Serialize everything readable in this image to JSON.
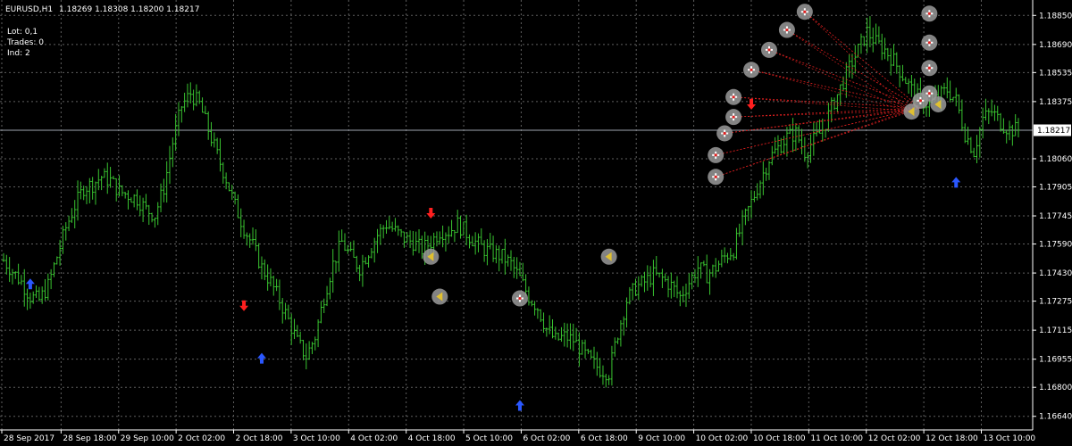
{
  "header": {
    "symbol": "EURUSD,H1",
    "ohlc": "1.18269 1.18308 1.18200 1.18217"
  },
  "info": {
    "lot": "Lot: 0,1",
    "trades": "Trades: 0",
    "ind": "Ind: 2"
  },
  "colors": {
    "background": "#000000",
    "grid": "#5f5f5f",
    "candles": "#39c430",
    "buy_arrow": "#2a57ff",
    "sell_arrow": "#ff1f1f",
    "trade_line": "#e02020",
    "marker": "#9a9a9a",
    "current_price_line": "#9fa6b0"
  },
  "chart_data": {
    "type": "candlestick",
    "symbol": "EURUSD",
    "timeframe": "H1",
    "ylim": [
      1.16565,
      1.18935
    ],
    "current_price": "1.18217",
    "y_ticks": [
      "1.18850",
      "1.18690",
      "1.18535",
      "1.18375",
      "1.18217",
      "1.18060",
      "1.17905",
      "1.17745",
      "1.17590",
      "1.17430",
      "1.17275",
      "1.17115",
      "1.16955",
      "1.16800",
      "1.16640"
    ],
    "x_ticks": [
      "28 Sep 2017",
      "28 Sep 18:00",
      "29 Sep 10:00",
      "2 Oct 02:00",
      "2 Oct 18:00",
      "3 Oct 10:00",
      "4 Oct 02:00",
      "4 Oct 18:00",
      "5 Oct 10:00",
      "6 Oct 02:00",
      "6 Oct 18:00",
      "9 Oct 10:00",
      "10 Oct 02:00",
      "10 Oct 18:00",
      "11 Oct 10:00",
      "12 Oct 02:00",
      "12 Oct 18:00",
      "13 Oct 10:00"
    ],
    "series_close": [
      1.175,
      1.1744,
      1.1738,
      1.173,
      1.1728,
      1.1736,
      1.1752,
      1.1768,
      1.178,
      1.179,
      1.1792,
      1.1796,
      1.1794,
      1.1788,
      1.1786,
      1.1784,
      1.1778,
      1.1775,
      1.179,
      1.1815,
      1.1835,
      1.1842,
      1.1836,
      1.1822,
      1.1808,
      1.1795,
      1.178,
      1.1768,
      1.1758,
      1.1746,
      1.1738,
      1.1728,
      1.1717,
      1.1705,
      1.1697,
      1.1708,
      1.173,
      1.1748,
      1.176,
      1.1752,
      1.1746,
      1.1755,
      1.1764,
      1.177,
      1.1766,
      1.1762,
      1.176,
      1.1756,
      1.176,
      1.1766,
      1.1766,
      1.177,
      1.1765,
      1.176,
      1.1756,
      1.1754,
      1.1752,
      1.1748,
      1.174,
      1.173,
      1.1724,
      1.1712,
      1.1706,
      1.1708,
      1.1706,
      1.17,
      1.1694,
      1.169,
      1.1688,
      1.171,
      1.1728,
      1.1735,
      1.1738,
      1.1742,
      1.174,
      1.1736,
      1.173,
      1.1738,
      1.1746,
      1.1742,
      1.1746,
      1.1752,
      1.1756,
      1.177,
      1.1782,
      1.1794,
      1.1806,
      1.1812,
      1.1818,
      1.182,
      1.181,
      1.1816,
      1.1822,
      1.1834,
      1.1845,
      1.1856,
      1.1866,
      1.1876,
      1.187,
      1.1866,
      1.186,
      1.1852,
      1.1844,
      1.1838,
      1.1836,
      1.184,
      1.1844,
      1.1838,
      1.182,
      1.181,
      1.1828,
      1.1832,
      1.1826,
      1.1822,
      1.1822
    ],
    "buy_arrows": [
      {
        "i": 3,
        "price": 1.1737
      },
      {
        "i": 29,
        "price": 1.1696
      },
      {
        "i": 58,
        "price": 1.167
      },
      {
        "i": 107,
        "price": 1.1793
      }
    ],
    "sell_arrows": [
      {
        "i": 27,
        "price": 1.1725
      },
      {
        "i": 48,
        "price": 1.1776
      },
      {
        "i": 84,
        "price": 1.1836
      }
    ],
    "circles": [
      {
        "i": 48,
        "price": 1.1752,
        "glyph": "tri"
      },
      {
        "i": 49,
        "price": 1.173,
        "glyph": "tri"
      },
      {
        "i": 58,
        "price": 1.1729,
        "glyph": "plus"
      },
      {
        "i": 68,
        "price": 1.1752,
        "glyph": "tri"
      },
      {
        "i": 80,
        "price": 1.1796,
        "glyph": "plus"
      },
      {
        "i": 80,
        "price": 1.1808,
        "glyph": "plus"
      },
      {
        "i": 81,
        "price": 1.182,
        "glyph": "plus"
      },
      {
        "i": 82,
        "price": 1.1829,
        "glyph": "plus"
      },
      {
        "i": 82,
        "price": 1.184,
        "glyph": "plus"
      },
      {
        "i": 84,
        "price": 1.1855,
        "glyph": "plus"
      },
      {
        "i": 86,
        "price": 1.1866,
        "glyph": "plus"
      },
      {
        "i": 88,
        "price": 1.1877,
        "glyph": "plus"
      },
      {
        "i": 90,
        "price": 1.1887,
        "glyph": "plus"
      },
      {
        "i": 102,
        "price": 1.1832,
        "glyph": "tri"
      },
      {
        "i": 103,
        "price": 1.1838,
        "glyph": "plus"
      },
      {
        "i": 104,
        "price": 1.1842,
        "glyph": "plus"
      },
      {
        "i": 105,
        "price": 1.1836,
        "glyph": "tri"
      },
      {
        "i": 104,
        "price": 1.1856,
        "glyph": "plus"
      },
      {
        "i": 104,
        "price": 1.187,
        "glyph": "plus"
      },
      {
        "i": 104,
        "price": 1.1886,
        "glyph": "plus"
      }
    ]
  }
}
